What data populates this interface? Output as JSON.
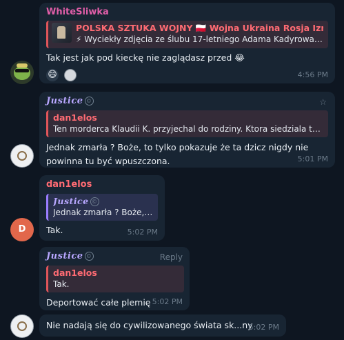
{
  "messages": {
    "m1": {
      "sender": "WhiteSliwka",
      "quote_title": "POLSKA SZTUKA WOJNY 🇵🇱 Wojna Ukraina Rosja Izrael...",
      "quote_text": "⚡ Wyciekły zdjęcia ze ślubu 17-letniego Adama Kadyrowa....",
      "text": "Tak jest jak pod kieckę nie zaglądasz przed 😂",
      "reactions": [
        "😄",
        "avatar-reaction"
      ],
      "time": "4:56 PM"
    },
    "m2": {
      "sender": "Justice",
      "quote_name": "dan1elos",
      "quote_text": "Ten morderca Klaudii K. przyjechal do rodziny. Ktora siedziala tu ...",
      "text": "Jednak zmarła ? Boże, to tylko pokazuje że ta dzicz nigdy nie powinna tu być wpuszczona.",
      "time": "5:01 PM"
    },
    "m3": {
      "sender": "dan1elos",
      "quote_name": "Justice",
      "quote_text": "Jednak zmarła ? Boże, t...",
      "text": "Tak.",
      "time": "5:02 PM",
      "avatar_letter": "D"
    },
    "m4": {
      "sender": "Justice",
      "reply_label": "Reply",
      "quote_name": "dan1elos",
      "quote_text": "Tak.",
      "text": "Deportować całe plemię",
      "time": "5:02 PM"
    },
    "m5": {
      "text": "Nie nadają się do cywilizowanego świata sk...ny",
      "time": "5:02 PM"
    }
  },
  "colors": {
    "background": "#0e1621",
    "bubble": "#182533",
    "sender_pink": "#e05ea8",
    "sender_red": "#ff6b73",
    "sender_violet": "#b8a7ff",
    "quote_bar_red": "#e0555a",
    "quote_bar_violet": "#9a7dff",
    "avatar_d": "#e2674b"
  },
  "icons": {
    "verified": "circle-c-icon",
    "star": "star-icon",
    "frog_avatar": "frog-sunglasses-avatar",
    "seal_avatar": "seal-emblem-avatar"
  }
}
